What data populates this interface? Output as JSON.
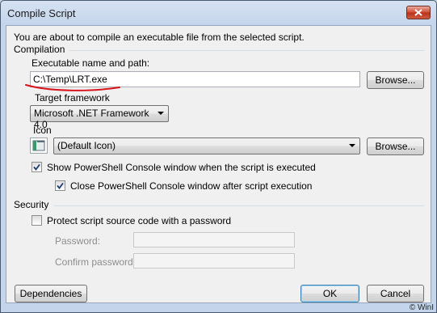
{
  "window": {
    "title": "Compile Script"
  },
  "intro_text": "You are about to compile an executable file from the selected script.",
  "compilation": {
    "group_label": "Compilation",
    "exe_label": "Executable name and path:",
    "exe_value": "C:\\Temp\\LRT.exe",
    "browse_label": "Browse...",
    "framework_label": "Target framework",
    "framework_value": "Microsoft .NET Framework 4.0",
    "icon_label": "Icon",
    "icon_value": "(Default Icon)",
    "icon_browse_label": "Browse...",
    "show_console_label": "Show PowerShell Console window when the script is executed",
    "show_console_checked": true,
    "close_console_label": "Close PowerShell Console window after script execution",
    "close_console_checked": true
  },
  "security": {
    "group_label": "Security",
    "protect_label": "Protect script source code with a password",
    "protect_checked": false,
    "password_label": "Password:",
    "confirm_label": "Confirm password:"
  },
  "buttons": {
    "dependencies": "Dependencies",
    "ok": "OK",
    "cancel": "Cancel"
  },
  "watermark": "© WinI",
  "colors": {
    "annotation_red": "#d9141e",
    "close_button": "#c9442d"
  }
}
